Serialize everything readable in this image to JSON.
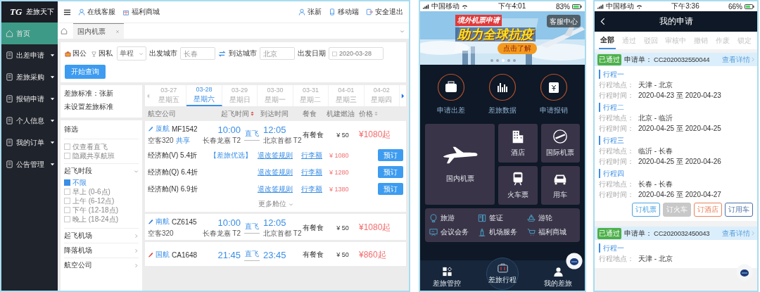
{
  "desktop": {
    "logo": {
      "mark": "TG",
      "name": "差旅天下"
    },
    "sidebar": [
      {
        "label": "首页",
        "selected": true,
        "expandable": false
      },
      {
        "label": "出差申请",
        "selected": false,
        "expandable": true
      },
      {
        "label": "差旅采购",
        "selected": false,
        "expandable": true
      },
      {
        "label": "报销申请",
        "selected": false,
        "expandable": true
      },
      {
        "label": "个人信息",
        "selected": false,
        "expandable": true
      },
      {
        "label": "我的订单",
        "selected": false,
        "expandable": true
      },
      {
        "label": "公告管理",
        "selected": false,
        "expandable": true
      }
    ],
    "top_links": [
      "在线客服",
      "福利商城"
    ],
    "user_links": [
      "张新",
      "移动端",
      "安全退出"
    ],
    "tabs": [
      {
        "label": "国内机票",
        "selected": true
      }
    ],
    "search": {
      "trip_types": [
        {
          "label": "因公",
          "selected": true
        },
        {
          "label": "因私",
          "selected": false
        }
      ],
      "trip_mode": "单程",
      "from_label": "出发城市",
      "from_placeholder": "长春",
      "to_label": "到达城市",
      "to_placeholder": "北京",
      "date_label": "出发日期",
      "date": "2020-03-28",
      "button": "开始查询"
    },
    "policy": [
      "差旅标准：张新",
      "未设置差旅标准"
    ],
    "filter": {
      "title": "筛选",
      "options": [
        {
          "label": "仅查看直飞",
          "checked": false
        },
        {
          "label": "隐藏共享航班",
          "checked": false
        }
      ],
      "time_group": {
        "title": "起飞时段",
        "expanded": true,
        "options": [
          {
            "label": "不限",
            "checked": true
          },
          {
            "label": "早上 (0-6点)",
            "checked": false
          },
          {
            "label": "上午 (6-12点)",
            "checked": false
          },
          {
            "label": "下午 (12-18点)",
            "checked": false
          },
          {
            "label": "晚上 (18-24点)",
            "checked": false
          }
        ]
      },
      "sections": [
        {
          "title": "起飞机场",
          "expanded": false
        },
        {
          "title": "降落机场",
          "expanded": false
        },
        {
          "title": "航空公司",
          "expanded": false
        }
      ]
    },
    "dates": [
      {
        "date": "03-27",
        "weekday": "星期五",
        "selected": false
      },
      {
        "date": "03-28",
        "weekday": "星期六",
        "selected": true
      },
      {
        "date": "03-29",
        "weekday": "星期日",
        "selected": false
      },
      {
        "date": "03-30",
        "weekday": "星期一",
        "selected": false
      },
      {
        "date": "03-31",
        "weekday": "星期二",
        "selected": false
      },
      {
        "date": "04-01",
        "weekday": "星期三",
        "selected": false
      },
      {
        "date": "04-02",
        "weekday": "星期四",
        "selected": false
      }
    ],
    "columns": [
      {
        "label": "航空公司"
      },
      {
        "label": "起飞时间",
        "sorted": true
      },
      {
        "label": "到达时间"
      },
      {
        "label": "餐食"
      },
      {
        "label": "机建燃油"
      },
      {
        "label": "价格",
        "sorted": false
      }
    ],
    "flights": [
      {
        "airline": "厦航",
        "number": "MF1542",
        "color": "#3a8ee6",
        "aircraft": "空客320",
        "shared": "共享",
        "dep": "10:00",
        "dep_airport": "长春龙嘉 T2",
        "stop": "直飞",
        "arr": "12:05",
        "arr_airport": "北京首都 T2",
        "meal": "有餐食",
        "tax": "¥ 50",
        "price": "¥1080起",
        "cabins": [
          {
            "name": "经济舱(V) 5.4折",
            "tag": "【差旅优选】",
            "rules": "退改签规则",
            "baggage": "行李额",
            "price": "¥ 1080",
            "button": "预订"
          },
          {
            "name": "经济舱(Q) 6.4折",
            "rules": "退改签规则",
            "baggage": "行李额",
            "price": "¥ 1280",
            "button": "预订"
          },
          {
            "name": "经济舱(N) 6.9折",
            "rules": "退改签规则",
            "baggage": "行李额",
            "price": "¥ 1380",
            "button": "预订"
          }
        ],
        "more": "更多舱位"
      },
      {
        "airline": "南航",
        "number": "CZ6145",
        "color": "#2b6fd6",
        "aircraft": "空客320",
        "dep": "10:00",
        "dep_airport": "长春龙嘉 T2",
        "stop": "直飞",
        "arr": "12:05",
        "arr_airport": "北京首都 T2",
        "meal": "有餐食",
        "tax": "¥ 50",
        "price": "¥1080起"
      },
      {
        "airline": "国航",
        "number": "CA1648",
        "color": "#e03a2f",
        "dep": "21:45",
        "stop": "直飞",
        "arr": "23:45",
        "meal": "有餐食",
        "tax": "¥ 50",
        "price": "¥860起"
      }
    ]
  },
  "phone_home": {
    "status": {
      "carrier": "中国移动",
      "time": "下午4:01",
      "battery": "83%"
    },
    "banner": {
      "tag": "境外机票申请",
      "headline": "助力全球抗疫",
      "cta": "点击了解",
      "service": "客服中心",
      "dots": [
        {
          "selected": false
        },
        {
          "selected": false
        },
        {
          "selected": true
        },
        {
          "selected": false
        },
        {
          "selected": false
        }
      ]
    },
    "actions": [
      "申请出差",
      "差旅数据",
      "申请报销"
    ],
    "tiles": [
      {
        "label": "国内机票",
        "kind": "large"
      },
      {
        "label": "酒店",
        "kind": "small"
      },
      {
        "label": "国际机票",
        "kind": "small"
      },
      {
        "label": "火车票",
        "kind": "small"
      },
      {
        "label": "用车",
        "kind": "small"
      }
    ],
    "services": [
      "旅游",
      "签证",
      "游轮",
      "会议会务",
      "机场服务",
      "福利商城"
    ],
    "tabbar": [
      {
        "label": "差旅管控",
        "kind": "normal"
      },
      {
        "label": "差旅行程",
        "kind": "center"
      },
      {
        "label": "我的差旅",
        "kind": "normal"
      }
    ]
  },
  "phone_applications": {
    "status": {
      "carrier": "中国移动",
      "time": "下午3:36",
      "battery": "66%"
    },
    "title": "我的申请",
    "tabs": [
      {
        "label": "全部",
        "selected": true
      },
      {
        "label": "通过",
        "selected": false
      },
      {
        "label": "驳回",
        "selected": false
      },
      {
        "label": "审核中",
        "selected": false
      },
      {
        "label": "撤销",
        "selected": false
      },
      {
        "label": "作废",
        "selected": false
      },
      {
        "label": "锁定",
        "selected": false
      }
    ],
    "applications": [
      {
        "status": "已通过",
        "number_label": "申请单：",
        "number": "CC2020032550044",
        "link": "查看详情",
        "trips": [
          {
            "title": "行程一",
            "place_label": "行程地点：",
            "place": "天津 - 北京",
            "time_label": "行程时间：",
            "time": "2020-04-23 至 2020-04-23"
          },
          {
            "title": "行程二",
            "place_label": "行程地点：",
            "place": "北京 - 临沂",
            "time_label": "行程时间：",
            "time": "2020-04-25 至 2020-04-25"
          },
          {
            "title": "行程三",
            "place_label": "行程地点：",
            "place": "临沂 - 长春",
            "time_label": "行程时间：",
            "time": "2020-04-25 至 2020-04-26"
          },
          {
            "title": "行程四",
            "place_label": "行程地点：",
            "place": "长春 - 长春",
            "time_label": "行程时间：",
            "time": "2020-04-26 至 2020-04-27"
          }
        ],
        "actions": [
          {
            "label": "订机票",
            "color": "#4aa3e0",
            "disabled": false
          },
          {
            "label": "订火车",
            "color": "#c8c8c8",
            "disabled": true
          },
          {
            "label": "订酒店",
            "color": "#e8825a",
            "disabled": false
          },
          {
            "label": "订用车",
            "color": "#4a6fa8",
            "disabled": false
          }
        ]
      },
      {
        "status": "已通过",
        "number_label": "申请单：",
        "number": "CC2020032450043",
        "link": "查看详情",
        "trips": [
          {
            "title": "行程一",
            "place_label": "行程地点：",
            "place": "天津 - 北京"
          }
        ]
      }
    ]
  }
}
